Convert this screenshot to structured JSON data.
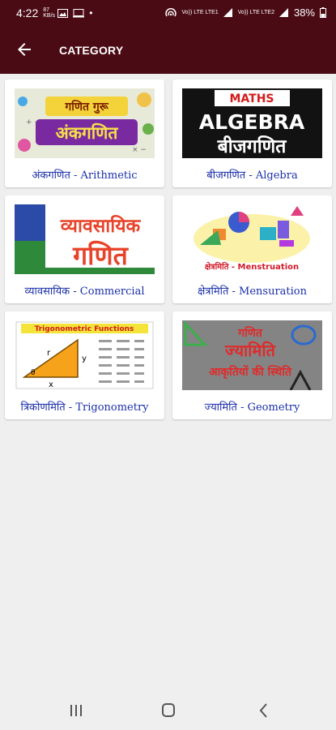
{
  "status_bar": {
    "time": "4:22",
    "net_speed": "87 KB/s",
    "lte_label_1": "Vo)) LTE LTE1",
    "lte_label_2": "Vo)) LTE LTE2",
    "battery": "38%"
  },
  "app_bar": {
    "title": "CATEGORY"
  },
  "categories": [
    {
      "label": "अंकगणित - Arithmetic",
      "thumb_top": "गणित गुरू",
      "thumb_main": "अंकगणित"
    },
    {
      "label": "बीजगणित - Algebra",
      "thumb_top": "MATHS",
      "thumb_mid": "ALGEBRA",
      "thumb_bottom": "बीजगणित"
    },
    {
      "label": "व्यावसायिक - Commercial",
      "thumb_line1": "व्यावसायिक",
      "thumb_line2": "गणित"
    },
    {
      "label": "क्षेत्रमिति - Mensuration",
      "thumb_caption": "क्षेत्रमिति - Menstruation"
    },
    {
      "label": "त्रिकोणमिति - Trigonometry",
      "thumb_title": "Trigonometric Functions",
      "thumb_r": "r",
      "thumb_y": "y",
      "thumb_x": "x",
      "thumb_theta": "θ"
    },
    {
      "label": "ज्यामिति - Geometry",
      "thumb_line1": "गणित",
      "thumb_line2": "ज्यामिति",
      "thumb_line3": "आकृतियों की स्थिति"
    }
  ],
  "colors": {
    "bar_bg": "#4a0b14",
    "label_blue": "#1a2fa8",
    "page_bg": "#efefef"
  },
  "nav_bar": {
    "icons": [
      "recent-apps-icon",
      "home-icon",
      "back-icon"
    ]
  }
}
